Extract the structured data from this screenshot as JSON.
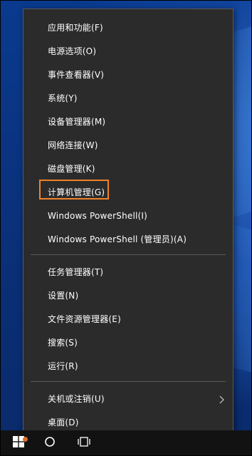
{
  "menu": {
    "group1": [
      {
        "label": "应用和功能(F)"
      },
      {
        "label": "电源选项(O)"
      },
      {
        "label": "事件查看器(V)"
      },
      {
        "label": "系统(Y)"
      },
      {
        "label": "设备管理器(M)"
      },
      {
        "label": "网络连接(W)"
      },
      {
        "label": "磁盘管理(K)"
      },
      {
        "label": "计算机管理(G)"
      },
      {
        "label": "Windows PowerShell(I)"
      },
      {
        "label": "Windows PowerShell (管理员)(A)"
      }
    ],
    "group2": [
      {
        "label": "任务管理器(T)"
      },
      {
        "label": "设置(N)"
      },
      {
        "label": "文件资源管理器(E)"
      },
      {
        "label": "搜索(S)"
      },
      {
        "label": "运行(R)"
      }
    ],
    "group3": [
      {
        "label": "关机或注销(U)",
        "has_submenu": true
      },
      {
        "label": "桌面(D)"
      }
    ]
  },
  "highlighted_item": "计算机管理(G)",
  "colors": {
    "menu_bg": "#2b2b2b",
    "menu_text": "#ffffff",
    "highlight_border": "#f0832b",
    "taskbar_bg": "#121212"
  },
  "taskbar": {
    "start_icon": "windows-logo-icon",
    "search_icon": "cortana-circle-icon",
    "taskview_icon": "task-view-icon"
  }
}
